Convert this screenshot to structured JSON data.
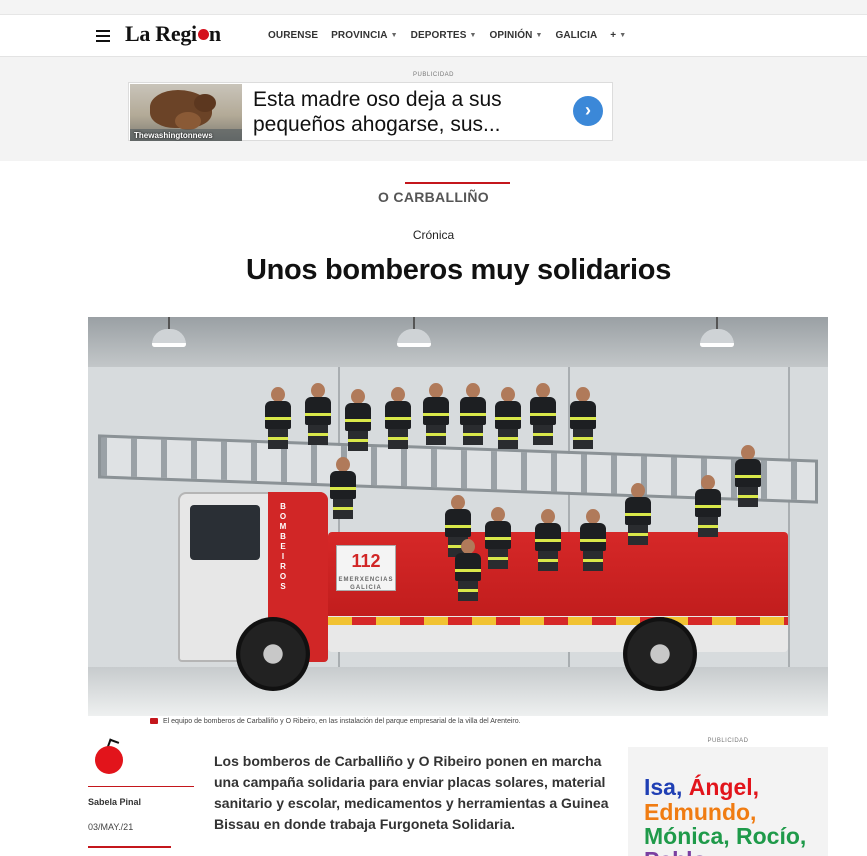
{
  "header": {
    "logo_text": "La Regi",
    "logo_text_end": "n",
    "nav": [
      {
        "label": "OURENSE",
        "dropdown": false
      },
      {
        "label": "PROVINCIA",
        "dropdown": true
      },
      {
        "label": "DEPORTES",
        "dropdown": true
      },
      {
        "label": "OPINIÓN",
        "dropdown": true
      },
      {
        "label": "GALICIA",
        "dropdown": false
      },
      {
        "label": "+",
        "dropdown": true
      }
    ]
  },
  "top_ad": {
    "label": "PUBLICIDAD",
    "text": "Esta madre oso deja a sus pequeños ahogarse, sus...",
    "source": "Thewashingtonnews",
    "arrow_icon": "chevron-right-icon",
    "accent": "#3b88d8"
  },
  "article": {
    "section": "O CARBALLIÑO",
    "kicker": "Crónica",
    "headline": "Unos bomberos muy solidarios",
    "photo": {
      "truck_number": "112",
      "truck_subtext": "EMERXENCIAS GALICIA",
      "side_text": [
        "B",
        "O",
        "M",
        "B",
        "E",
        "I",
        "R",
        "O",
        "S"
      ]
    },
    "caption": "El equipo de bomberos de Carballiño y O Ribeiro, en las instalación del parque empresarial de la villa del Arenteiro.",
    "author": "Sabela Pinal",
    "date": "03/MAY./21",
    "standfirst": "Los bomberos de Carballiño y O Ribeiro ponen en marcha una campaña solidaria para enviar placas solares, material sanitario y escolar, medicamentos y herramientas a Guinea Bissau en donde trabaja Furgoneta Solidaria."
  },
  "side_ad": {
    "label": "PUBLICIDAD",
    "lines": [
      [
        {
          "text": "Isa, ",
          "color": "#1f3fb4"
        },
        {
          "text": "Ángel,",
          "color": "#e2141b"
        }
      ],
      [
        {
          "text": "Edmundo,",
          "color": "#f07c12"
        }
      ],
      [
        {
          "text": "Mónica, ",
          "color": "#1f9a4a"
        },
        {
          "text": "Rocío,",
          "color": "#1f9a4a"
        }
      ],
      [
        {
          "text": "Pablo",
          "color": "#7a3fa1"
        }
      ]
    ]
  },
  "colors": {
    "brand_red": "#c4161c"
  }
}
